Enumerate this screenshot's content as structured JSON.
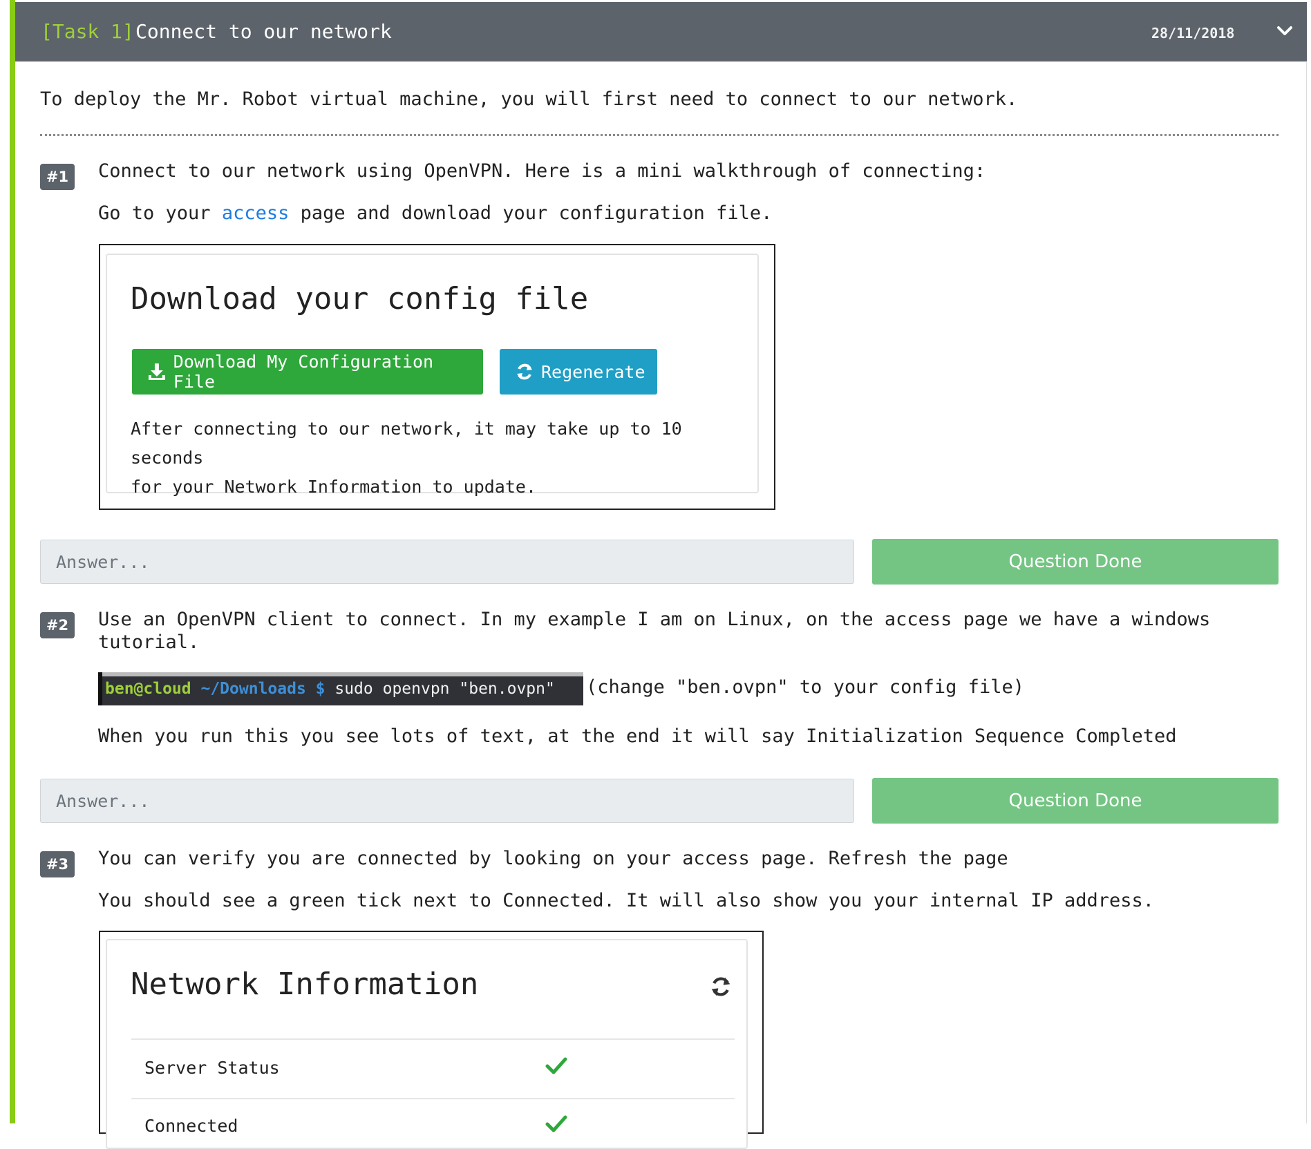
{
  "header": {
    "task_tag": "[Task 1]",
    "task_title": "Connect to our network",
    "date": "28/11/2018",
    "accent": "#88cc14",
    "header_bg": "#5c636b"
  },
  "intro": "To deploy the Mr. Robot virtual machine, you will first need to connect to our network.",
  "questions": [
    {
      "number": "#1",
      "text": "Connect to our network using OpenVPN. Here is a mini walkthrough of connecting:",
      "line2_before": "Go to your ",
      "line2_link": "access",
      "line2_after": " page and download your configuration file.",
      "image": {
        "title": "Download your config file",
        "download_button": "Download My Configuration File",
        "regenerate_button": "Regenerate",
        "note_line1": "After connecting to our network, it may take up to 10 seconds",
        "note_line2": "for your Network Information to update."
      },
      "answer_placeholder": "Answer...",
      "done_label": "Question Done"
    },
    {
      "number": "#2",
      "text_line1": "Use an OpenVPN client to connect. In my example I am on Linux, on the access page we have a windows",
      "text_line2": "tutorial.",
      "terminal": {
        "user": "ben@cloud",
        "path": "~/Downloads $",
        "command": "sudo openvpn \"ben.ovpn\""
      },
      "terminal_note": "(change \"ben.ovpn\" to your config file)",
      "line3": "When you run this you see lots of text, at the end it will say Initialization Sequence Completed",
      "answer_placeholder": "Answer...",
      "done_label": "Question Done"
    },
    {
      "number": "#3",
      "text_line1": "You can verify you are connected by looking on your access page. Refresh the page",
      "text_line2": "You should see a green tick next to Connected. It will also show you your internal IP address.",
      "image": {
        "title": "Network Information",
        "rows": [
          {
            "label": "Server Status",
            "icon": "check-icon"
          },
          {
            "label": "Connected",
            "icon": "check-icon"
          }
        ]
      }
    }
  ],
  "icons": [
    "chevron-down-icon",
    "download-icon",
    "refresh-icon",
    "check-icon"
  ]
}
